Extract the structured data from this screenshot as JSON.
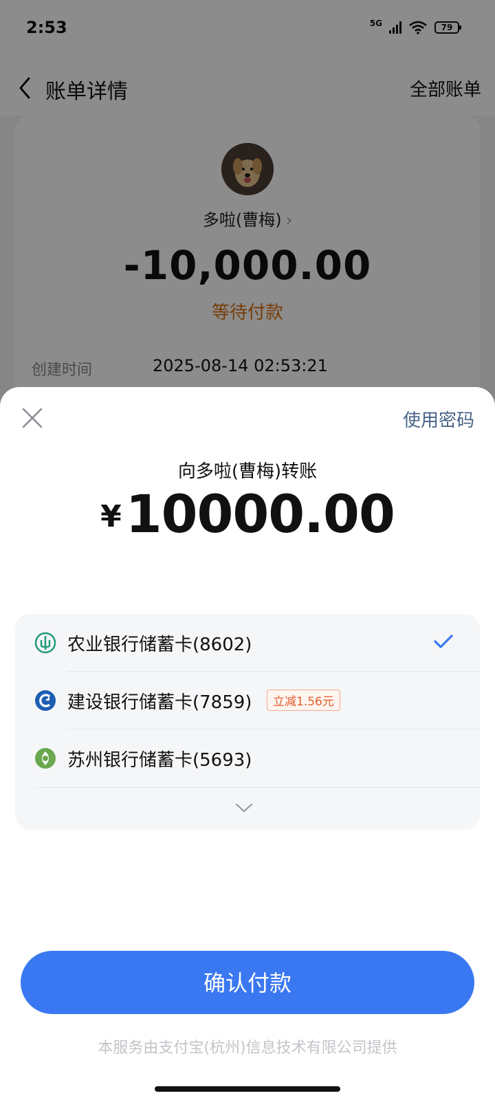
{
  "status_bar": {
    "time": "2:53",
    "network": "5G",
    "battery": "79"
  },
  "nav": {
    "title": "账单详情",
    "right_link": "全部账单"
  },
  "bill": {
    "payee": "多啦(曹梅)",
    "amount": "-10,000.00",
    "status": "等待付款",
    "created_label": "创建时间",
    "created_value": "2025-08-14 02:53:21"
  },
  "sheet": {
    "use_password": "使用密码",
    "transfer_to": "向多啦(曹梅)转账",
    "currency": "¥",
    "amount": "10000.00",
    "cards": [
      {
        "name": "农业银行储蓄卡(8602)",
        "icon": "abc-bank-icon",
        "selected": true
      },
      {
        "name": "建设银行储蓄卡(7859)",
        "icon": "ccb-bank-icon",
        "promo": "立减1.56元"
      },
      {
        "name": "苏州银行储蓄卡(5693)",
        "icon": "suzhou-bank-icon"
      }
    ],
    "confirm": "确认付款",
    "footer": "本服务由支付宝(杭州)信息技术有限公司提供"
  },
  "colors": {
    "accent": "#3a78f2",
    "status_orange": "#d9700f",
    "promo": "#e25a2b",
    "link": "#4a6488"
  }
}
